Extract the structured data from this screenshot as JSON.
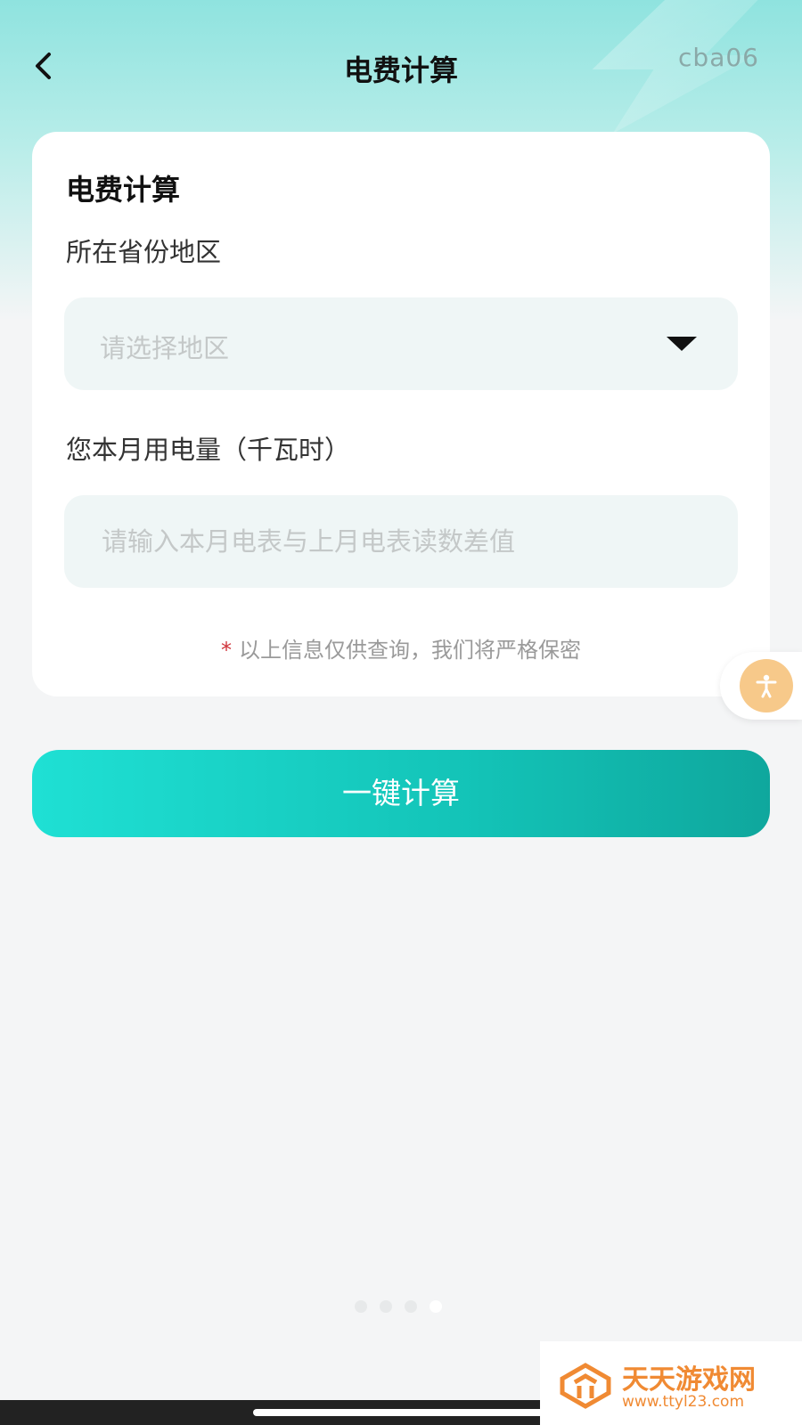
{
  "header": {
    "title": "电费计算",
    "tag": "cba06"
  },
  "card": {
    "title": "电费计算",
    "region_label": "所在省份地区",
    "region_placeholder": "请选择地区",
    "usage_label": "您本月用电量（千瓦时）",
    "usage_placeholder": "请输入本月电表与上月电表读数差值",
    "note_star": "*",
    "note_text": "以上信息仅供查询，我们将严格保密"
  },
  "actions": {
    "calculate_label": "一键计算"
  },
  "pager": {
    "count": 4,
    "active_index": 3
  },
  "watermark": {
    "name": "天天游戏网",
    "url": "www.ttyl23.com"
  },
  "colors": {
    "accent": "#13c3b7",
    "header_gradient": "#8fe3df",
    "note_star": "#d0333a",
    "float_button": "#f7c98a",
    "watermark": "#f08a33"
  }
}
